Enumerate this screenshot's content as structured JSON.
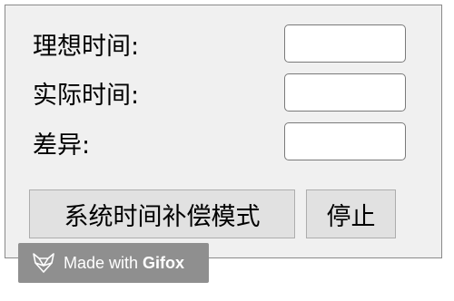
{
  "form": {
    "ideal_time_label": "理想时间:",
    "actual_time_label": "实际时间:",
    "difference_label": "差异:",
    "ideal_time_value": "",
    "actual_time_value": "",
    "difference_value": ""
  },
  "buttons": {
    "compensation_mode": "系统时间补偿模式",
    "stop": "停止"
  },
  "watermark": {
    "prefix": "Made with",
    "brand": "Gifox",
    "icon": "fox-logo-icon"
  }
}
